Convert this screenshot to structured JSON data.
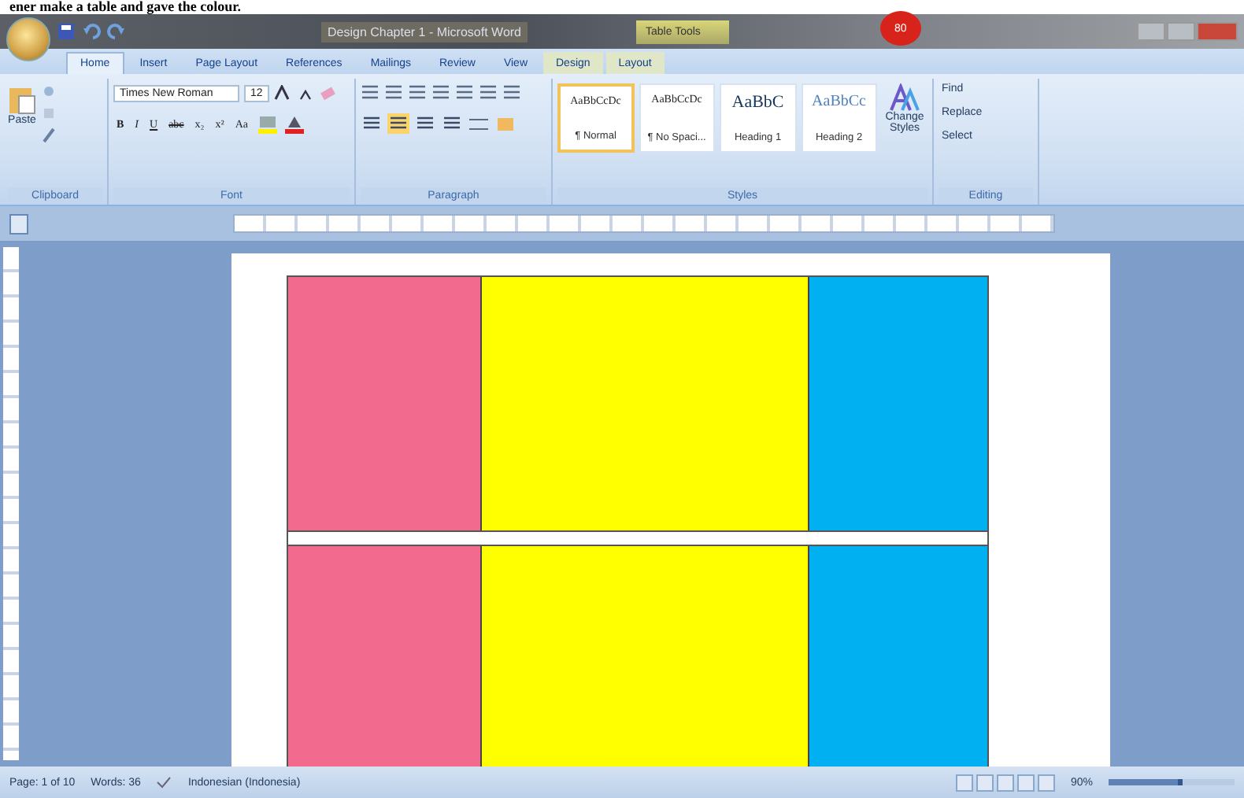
{
  "caption": "ener make a table and gave the colour.",
  "window": {
    "title": "Design Chapter 1 - Microsoft Word",
    "context_tab": "Table Tools",
    "badge": "80"
  },
  "tabs": [
    {
      "label": "Home",
      "selected": true
    },
    {
      "label": "Insert",
      "selected": false
    },
    {
      "label": "Page Layout",
      "selected": false
    },
    {
      "label": "References",
      "selected": false
    },
    {
      "label": "Mailings",
      "selected": false
    },
    {
      "label": "Review",
      "selected": false
    },
    {
      "label": "View",
      "selected": false
    },
    {
      "label": "Design",
      "selected": false
    },
    {
      "label": "Layout",
      "selected": false
    }
  ],
  "ribbon": {
    "paste_label": "Paste",
    "font": "Times New Roman",
    "size": "12",
    "format_buttons": [
      {
        "label": "B",
        "pressed": false
      },
      {
        "label": "I",
        "pressed": false
      },
      {
        "label": "U",
        "pressed": false
      },
      {
        "label": "abc",
        "pressed": false
      },
      {
        "label": "x₂",
        "pressed": false
      },
      {
        "label": "x²",
        "pressed": false
      },
      {
        "label": "Aa",
        "pressed": false
      }
    ],
    "align_buttons": [
      {
        "pressed": false
      },
      {
        "pressed": true
      },
      {
        "pressed": false
      },
      {
        "pressed": false
      }
    ],
    "styles": [
      {
        "sample": "AaBbCcDc",
        "name": "¶ Normal",
        "selected": true
      },
      {
        "sample": "AaBbCcDc",
        "name": "¶ No Spaci...",
        "selected": false
      },
      {
        "sample": "AaBbC",
        "name": "Heading 1",
        "selected": false
      },
      {
        "sample": "AaBbCc",
        "name": "Heading 2",
        "selected": false
      }
    ],
    "change_styles": "Change Styles",
    "editing": [
      "Find",
      "Replace",
      "Select"
    ],
    "groups": [
      "Clipboard",
      "Font",
      "Paragraph",
      "Styles",
      "Editing"
    ]
  },
  "table": {
    "rows": [
      {
        "cells": [
          {
            "color": "#f26b8e"
          },
          {
            "color": "#ffff00"
          },
          {
            "color": "#00b0f0"
          }
        ]
      },
      {
        "cells": [
          {
            "color": "#f26b8e"
          },
          {
            "color": "#ffff00"
          },
          {
            "color": "#00b0f0"
          }
        ]
      }
    ]
  },
  "status_bar": {
    "page": "Page: 1 of 10",
    "words": "Words: 36",
    "language": "Indonesian (Indonesia)",
    "zoom": "90%",
    "level": 0.55
  }
}
